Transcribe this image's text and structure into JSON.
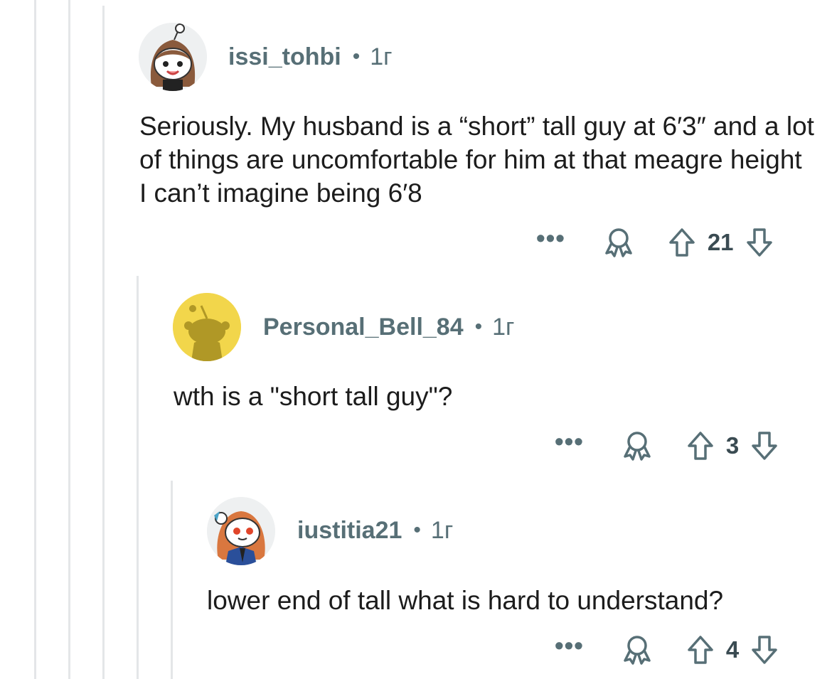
{
  "comments": [
    {
      "username": "issi_tohbi",
      "separator": "•",
      "age": "1г",
      "text": "Seriously. My husband is a “short” tall guy at 6′3″ and a lot of things are uncomfortable for him at that meagre height I can’t imagine being 6′8",
      "more_label": "•••",
      "votes": "21",
      "avatar_icon": "snoo-girl-dark-hair-avatar"
    },
    {
      "username": "Personal_Bell_84",
      "separator": "•",
      "age": "1г",
      "text": "wth is a \"short tall guy\"?",
      "more_label": "•••",
      "votes": "3",
      "avatar_icon": "snoo-silhouette-yellow-avatar"
    },
    {
      "username": "iustitia21",
      "separator": "•",
      "age": "1г",
      "text": "lower end of tall what is hard to understand?",
      "more_label": "•••",
      "votes": "4",
      "avatar_icon": "snoo-girl-red-hair-avatar"
    }
  ],
  "colors": {
    "meta_text": "#576f76",
    "body_text": "#1c1c1c",
    "thread_line": "#e4e6e8",
    "yellow_avatar": "#f2d64b"
  }
}
